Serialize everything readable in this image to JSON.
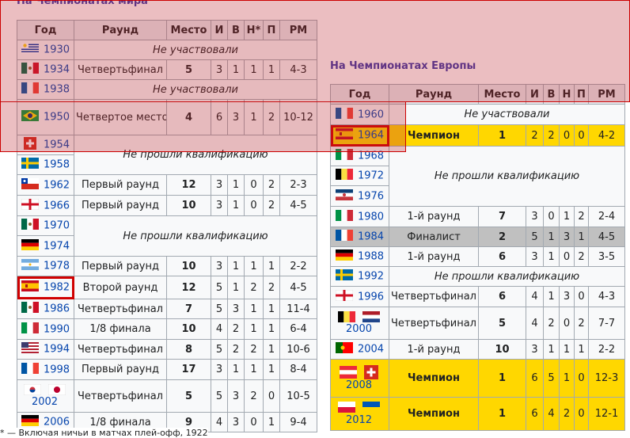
{
  "wc": {
    "title": "На Чемпионатах мира",
    "headers": [
      "Год",
      "Раунд",
      "Место",
      "И",
      "В",
      "Н*",
      "П",
      "РМ"
    ],
    "not_participated": "Не участвовали",
    "not_qualified": "Не прошли квалификацию",
    "rows": [
      {
        "year": "1930",
        "flag": "uru",
        "round": "",
        "place": "",
        "p": "",
        "w": "",
        "d": "",
        "l": "",
        "gd": ""
      },
      {
        "year": "1934",
        "flag": "mex",
        "round": "Четвертьфинал",
        "place": "5",
        "p": "3",
        "w": "1",
        "d": "1",
        "l": "1",
        "gd": "4-3"
      },
      {
        "year": "1938",
        "flag": "fra",
        "round": "",
        "place": "",
        "p": "",
        "w": "",
        "d": "",
        "l": "",
        "gd": ""
      },
      {
        "year": "1950",
        "flag": "bra",
        "round": "Четвертое место",
        "place": "4",
        "p": "6",
        "w": "3",
        "d": "1",
        "l": "2",
        "gd": "10-12"
      },
      {
        "year": "1954",
        "flag": "sui",
        "round": "",
        "place": "",
        "p": "",
        "w": "",
        "d": "",
        "l": "",
        "gd": ""
      },
      {
        "year": "1958",
        "flag": "swe",
        "round": "",
        "place": "",
        "p": "",
        "w": "",
        "d": "",
        "l": "",
        "gd": ""
      },
      {
        "year": "1962",
        "flag": "chi",
        "round": "Первый раунд",
        "place": "12",
        "p": "3",
        "w": "1",
        "d": "0",
        "l": "2",
        "gd": "2-3"
      },
      {
        "year": "1966",
        "flag": "eng",
        "round": "Первый раунд",
        "place": "10",
        "p": "3",
        "w": "1",
        "d": "0",
        "l": "2",
        "gd": "4-5"
      },
      {
        "year": "1970",
        "flag": "mex",
        "round": "",
        "place": "",
        "p": "",
        "w": "",
        "d": "",
        "l": "",
        "gd": ""
      },
      {
        "year": "1974",
        "flag": "ger",
        "round": "",
        "place": "",
        "p": "",
        "w": "",
        "d": "",
        "l": "",
        "gd": ""
      },
      {
        "year": "1978",
        "flag": "arg",
        "round": "Первый раунд",
        "place": "10",
        "p": "3",
        "w": "1",
        "d": "1",
        "l": "1",
        "gd": "2-2"
      },
      {
        "year": "1982",
        "flag": "esp",
        "round": "Второй раунд",
        "place": "12",
        "p": "5",
        "w": "1",
        "d": "2",
        "l": "2",
        "gd": "4-5"
      },
      {
        "year": "1986",
        "flag": "mex",
        "round": "Четвертьфинал",
        "place": "7",
        "p": "5",
        "w": "3",
        "d": "1",
        "l": "1",
        "gd": "11-4"
      },
      {
        "year": "1990",
        "flag": "ita",
        "round": "1/8 финала",
        "place": "10",
        "p": "4",
        "w": "2",
        "d": "1",
        "l": "1",
        "gd": "6-4"
      },
      {
        "year": "1994",
        "flag": "usa",
        "round": "Четвертьфинал",
        "place": "8",
        "p": "5",
        "w": "2",
        "d": "2",
        "l": "1",
        "gd": "10-6"
      },
      {
        "year": "1998",
        "flag": "fra",
        "round": "Первый раунд",
        "place": "17",
        "p": "3",
        "w": "1",
        "d": "1",
        "l": "1",
        "gd": "8-4"
      },
      {
        "year": "2002",
        "flag": "korjpn",
        "round": "Четвертьфинал",
        "place": "5",
        "p": "5",
        "w": "3",
        "d": "2",
        "l": "0",
        "gd": "10-5"
      },
      {
        "year": "2006",
        "flag": "ger",
        "round": "1/8 финала",
        "place": "9",
        "p": "4",
        "w": "3",
        "d": "0",
        "l": "1",
        "gd": "9-4"
      }
    ]
  },
  "eu": {
    "title": "На Чемпионатах Европы",
    "headers": [
      "Год",
      "Раунд",
      "Место",
      "И",
      "В",
      "Н",
      "П",
      "РМ"
    ],
    "not_participated": "Не участвовали",
    "not_qualified": "Не прошли квалификацию",
    "rows": [
      {
        "year": "1960",
        "flag": "fra"
      },
      {
        "year": "1964",
        "flag": "esp",
        "round": "Чемпион",
        "place": "1",
        "p": "2",
        "w": "2",
        "d": "0",
        "l": "0",
        "gd": "4-2"
      },
      {
        "year": "1968",
        "flag": "ita"
      },
      {
        "year": "1972",
        "flag": "bel"
      },
      {
        "year": "1976",
        "flag": "yug"
      },
      {
        "year": "1980",
        "flag": "ita",
        "round": "1-й раунд",
        "place": "7",
        "p": "3",
        "w": "0",
        "d": "1",
        "l": "2",
        "gd": "2-4"
      },
      {
        "year": "1984",
        "flag": "fra",
        "round": "Финалист",
        "place": "2",
        "p": "5",
        "w": "1",
        "d": "3",
        "l": "1",
        "gd": "4-5"
      },
      {
        "year": "1988",
        "flag": "ger",
        "round": "1-й раунд",
        "place": "6",
        "p": "3",
        "w": "1",
        "d": "0",
        "l": "2",
        "gd": "3-5"
      },
      {
        "year": "1992",
        "flag": "swe"
      },
      {
        "year": "1996",
        "flag": "eng",
        "round": "Четвертьфинал",
        "place": "6",
        "p": "4",
        "w": "1",
        "d": "3",
        "l": "0",
        "gd": "4-3"
      },
      {
        "year": "2000",
        "flag": "belned",
        "round": "Четвертьфинал",
        "place": "5",
        "p": "4",
        "w": "2",
        "d": "0",
        "l": "2",
        "gd": "7-7"
      },
      {
        "year": "2004",
        "flag": "por",
        "round": "1-й раунд",
        "place": "10",
        "p": "3",
        "w": "1",
        "d": "1",
        "l": "1",
        "gd": "2-2"
      },
      {
        "year": "2008",
        "flag": "autsui",
        "round": "Чемпион",
        "place": "1",
        "p": "6",
        "w": "5",
        "d": "1",
        "l": "0",
        "gd": "12-3"
      },
      {
        "year": "2012",
        "flag": "polukr",
        "round": "Чемпион",
        "place": "1",
        "p": "6",
        "w": "4",
        "d": "2",
        "l": "0",
        "gd": "12-1"
      }
    ]
  },
  "footnote": "* — Включая ничьи в матчах плей-офф, 1922"
}
